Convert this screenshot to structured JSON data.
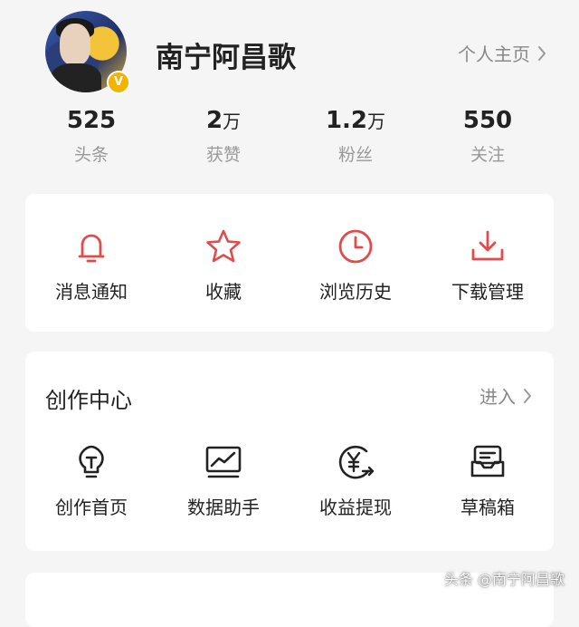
{
  "profile": {
    "username": "南宁阿昌歌",
    "homepage_label": "个人主页",
    "badge": "V"
  },
  "stats": [
    {
      "value": "525",
      "unit": "",
      "label": "头条"
    },
    {
      "value": "2",
      "unit": "万",
      "label": "获赞"
    },
    {
      "value": "1.2",
      "unit": "万",
      "label": "粉丝"
    },
    {
      "value": "550",
      "unit": "",
      "label": "关注"
    }
  ],
  "quick_actions": [
    {
      "label": "消息通知",
      "icon": "bell-icon"
    },
    {
      "label": "收藏",
      "icon": "star-icon"
    },
    {
      "label": "浏览历史",
      "icon": "clock-icon"
    },
    {
      "label": "下载管理",
      "icon": "download-icon"
    }
  ],
  "creation_center": {
    "title": "创作中心",
    "enter_label": "进入",
    "items": [
      {
        "label": "创作首页",
        "icon": "lightbulb-icon"
      },
      {
        "label": "数据助手",
        "icon": "chart-monitor-icon"
      },
      {
        "label": "收益提现",
        "icon": "yuan-coin-icon"
      },
      {
        "label": "草稿箱",
        "icon": "drafts-box-icon"
      }
    ]
  },
  "watermark": "头条 @南宁阿昌歌",
  "colors": {
    "accent_red": "#e24b4b",
    "text_dark": "#222222",
    "text_muted": "#999999",
    "background": "#f5f5f5"
  }
}
